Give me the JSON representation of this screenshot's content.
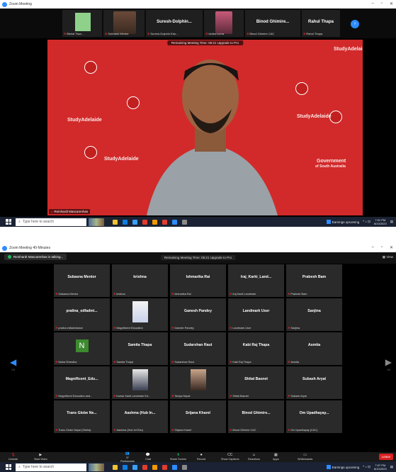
{
  "shot1": {
    "title": "Zoom Meeting",
    "window_controls": [
      "–",
      "▫",
      "✕"
    ],
    "strip_tiles": [
      {
        "name": "",
        "label": "Bishal Tiwa..."
      },
      {
        "name": "",
        "label": "Subhash Mentor"
      },
      {
        "name": "Suresh-Dolphin...",
        "label": "Suresh-Dolphin Edu..."
      },
      {
        "name": "",
        "label": "Ishika Luma"
      },
      {
        "name": "Binod Ghimire...",
        "label": "Binod Ghimire CAC"
      },
      {
        "name": "Rahul Thapa",
        "label": "Rahul Thapa"
      }
    ],
    "banner": "Remaining Meeting Time: 06:21 Upgrade to Pro",
    "speaker_label": "Reinhardt Mascarenhas",
    "backdrop": {
      "brand": "StudyAdelaide",
      "gov_line1": "Government",
      "gov_line2": "of South Australia"
    }
  },
  "shot2": {
    "title": "Zoom Meeting 40-Minutes",
    "talking": "Reinhardt Mascarenhas is talking...",
    "banner": "Remaining Meeting Time: 06:21 Upgrade to Pro",
    "view": "View",
    "page_left": "1/3",
    "page_right": "1/3",
    "tiles": [
      {
        "name": "Subasna Mentor",
        "label": "Subasna Mentor"
      },
      {
        "name": "krishna",
        "label": "krishna"
      },
      {
        "name": "Ishmarika Rai",
        "label": "Ishmarika Rai"
      },
      {
        "name": "Iraj_Karki_Land...",
        "label": "Iraj Karki Landmark"
      },
      {
        "name": "Prabesh Bam",
        "label": "Prabesh Bam"
      },
      {
        "name": "pralina_edfadmi...",
        "label": "pralina edfadmission"
      },
      {
        "name": "",
        "label": "Magnificent Education"
      },
      {
        "name": "Ganesh Pandey",
        "label": "Ganesh Pandey"
      },
      {
        "name": "Landmark User",
        "label": "Landmark User"
      },
      {
        "name": "Sanjina",
        "label": "Sanjina"
      },
      {
        "name": "",
        "avatar": "N",
        "label": "Nisha Shrestha"
      },
      {
        "name": "Samita Thapa",
        "label": "Samita Thapa"
      },
      {
        "name": "Sudarshan Raut",
        "label": "Sudarshan Raut"
      },
      {
        "name": "Kabi Raj Thapa",
        "label": "Kabi Raj Thapa"
      },
      {
        "name": "Asmita",
        "label": "Asmita"
      },
      {
        "name": "Magnificent_Edu...",
        "label": "Magnificent Education and..."
      },
      {
        "name": "",
        "label": "Kumar Karki Landmark Ed..."
      },
      {
        "name": "",
        "label": "Taniya Nepal"
      },
      {
        "name": "Shital Basnet",
        "label": "Shital Basnet"
      },
      {
        "name": "Subash Aryal",
        "label": "Subash Aryal"
      },
      {
        "name": "Trans Globe Ne...",
        "label": "Trans Globe Nepal (Sirkha)"
      },
      {
        "name": "Aashma (Hub In...",
        "label": "Aashma (Hub Int Edu)"
      },
      {
        "name": "Srijana Kharel",
        "label": "Srijana Kharel"
      },
      {
        "name": "Binod Ghimire...",
        "label": "Binod Ghimire CAC"
      },
      {
        "name": "Om Upadhayay...",
        "label": "Om Upadhayay (CAC)"
      }
    ],
    "controls": [
      {
        "icon": "mic-icon",
        "glyph": "🎙",
        "label": "Unmute"
      },
      {
        "icon": "video-icon",
        "glyph": "▶",
        "label": "Start Video"
      },
      {
        "icon": "participants-icon",
        "glyph": "👥",
        "label": "Participants",
        "count": "37"
      },
      {
        "icon": "chat-icon",
        "glyph": "💬",
        "label": "Chat"
      },
      {
        "icon": "share-screen-icon",
        "glyph": "⬆",
        "label": "Share Screen"
      },
      {
        "icon": "record-icon",
        "glyph": "⏺",
        "label": "Record"
      },
      {
        "icon": "captions-icon",
        "glyph": "CC",
        "label": "Show Captions"
      },
      {
        "icon": "reactions-icon",
        "glyph": "☺",
        "label": "Reactions"
      },
      {
        "icon": "apps-icon",
        "glyph": "▦",
        "label": "Apps"
      },
      {
        "icon": "whiteboards-icon",
        "glyph": "▭",
        "label": "Whiteboards"
      }
    ],
    "end": "Leave"
  },
  "taskbar": {
    "search_placeholder": "Type here to search",
    "weather": "Earnings upcoming",
    "time1": "7:01 PM",
    "date1": "8/10/2023",
    "time2": "7:07 PM",
    "date2": "8/10/2023"
  },
  "colors": {
    "zoom_blue": "#2d8cff",
    "backdrop_red": "#d22a2a",
    "tile_bg": "#2a2a2a",
    "mute_red": "#e02828",
    "share_green": "#1ebb5a",
    "end_red": "#d92121"
  }
}
